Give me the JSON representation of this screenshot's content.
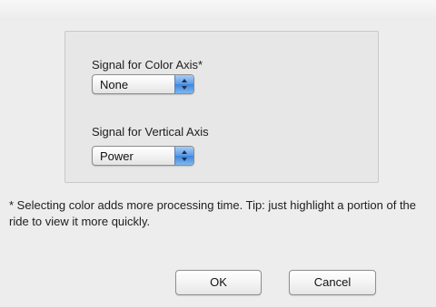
{
  "dialog": {
    "color_axis": {
      "label": "Signal for Color Axis*",
      "selected": "None"
    },
    "vertical_axis": {
      "label": "Signal for Vertical Axis",
      "selected": "Power"
    },
    "note": "* Selecting color adds more processing time.  Tip: just highlight a portion of the ride to view it more quickly.",
    "ok_label": "OK",
    "cancel_label": "Cancel"
  },
  "icons": {
    "popup_arrows": "up-down-arrows-icon"
  },
  "colors": {
    "background": "#ededed",
    "stepper_blue": "#4a8fe0"
  }
}
